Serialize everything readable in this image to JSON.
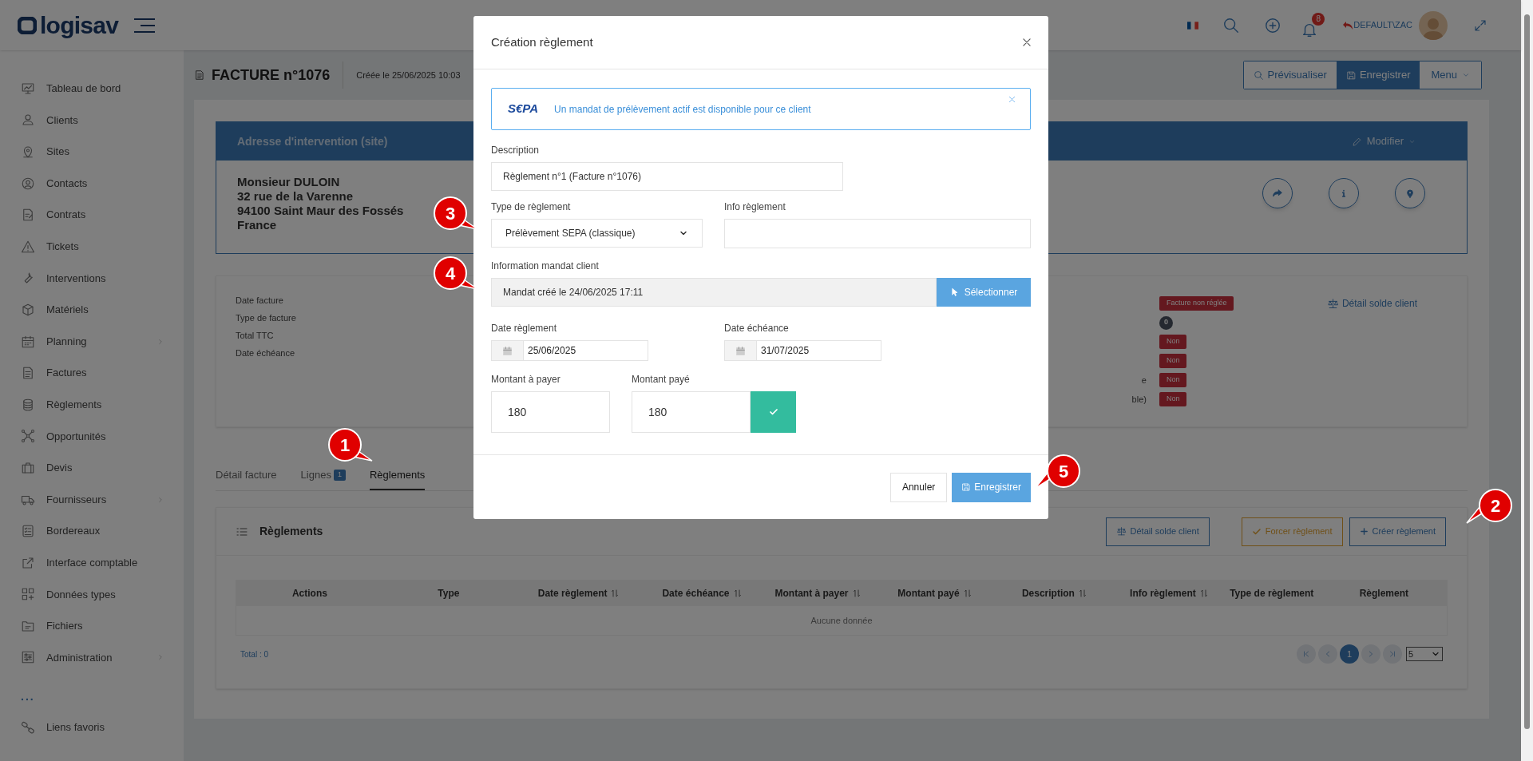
{
  "header": {
    "logo": "logisav",
    "notifications": "8",
    "user": "DEFAULT\\ZAC"
  },
  "sidebar": {
    "items": [
      {
        "label": "Tableau de bord",
        "has_submenu": false
      },
      {
        "label": "Clients",
        "has_submenu": false
      },
      {
        "label": "Sites",
        "has_submenu": false
      },
      {
        "label": "Contacts",
        "has_submenu": false
      },
      {
        "label": "Contrats",
        "has_submenu": false
      },
      {
        "label": "Tickets",
        "has_submenu": false
      },
      {
        "label": "Interventions",
        "has_submenu": false
      },
      {
        "label": "Matériels",
        "has_submenu": false
      },
      {
        "label": "Planning",
        "has_submenu": true
      },
      {
        "label": "Factures",
        "has_submenu": false
      },
      {
        "label": "Règlements",
        "has_submenu": false
      },
      {
        "label": "Opportunités",
        "has_submenu": false
      },
      {
        "label": "Devis",
        "has_submenu": false
      },
      {
        "label": "Fournisseurs",
        "has_submenu": true
      },
      {
        "label": "Bordereaux",
        "has_submenu": false
      },
      {
        "label": "Interface comptable",
        "has_submenu": false
      },
      {
        "label": "Données types",
        "has_submenu": false
      },
      {
        "label": "Fichiers",
        "has_submenu": false
      },
      {
        "label": "Administration",
        "has_submenu": true
      }
    ],
    "more": "...",
    "favorites": "Liens favoris"
  },
  "page": {
    "title": "FACTURE n°1076",
    "created": "Créée le 25/06/2025 10:03",
    "toolbar": [
      {
        "label": "Prévisualiser",
        "kind": "preview"
      },
      {
        "label": "Enregistrer",
        "kind": "save"
      },
      {
        "label": "Menu",
        "kind": "dropdown"
      }
    ]
  },
  "address": {
    "title": "Adresse d'intervention (site)",
    "edit": "Modifier",
    "lines": [
      "Monsieur DULOIN",
      "32 rue de la Varenne",
      "94100 Saint Maur des Fossés",
      "France"
    ]
  },
  "info": {
    "labels": [
      "Date facture",
      "Type de facture",
      "Total TTC",
      "Date échéance"
    ],
    "status_rows": [
      {
        "label": "",
        "badge": "Facture non réglée",
        "kind": "danger"
      },
      {
        "label": "",
        "badge": "0",
        "kind": "count"
      },
      {
        "label": "",
        "badge": "Non",
        "kind": "danger"
      },
      {
        "label": "",
        "badge": "Non",
        "kind": "danger"
      },
      {
        "label": "e",
        "badge": "Non",
        "kind": "danger"
      },
      {
        "label": "ble)",
        "badge": "Non",
        "kind": "danger"
      }
    ],
    "link": "Détail solde client"
  },
  "tabs": [
    {
      "label": "Détail facture",
      "selected": false
    },
    {
      "label": "Lignes",
      "badge": "1",
      "selected": false
    },
    {
      "label": "Règlements",
      "selected": true
    }
  ],
  "payments": {
    "title": "Règlements",
    "buttons": [
      {
        "label": "Détail solde client",
        "kind": "balance"
      },
      {
        "label": "Forcer règlement",
        "kind": "force"
      },
      {
        "label": "Créer règlement",
        "kind": "create"
      }
    ],
    "columns": [
      {
        "label": "Actions",
        "sortable": false
      },
      {
        "label": "Type",
        "sortable": false
      },
      {
        "label": "Date règlement",
        "sortable": true
      },
      {
        "label": "Date échéance",
        "sortable": true
      },
      {
        "label": "Montant à payer",
        "sortable": true
      },
      {
        "label": "Montant payé",
        "sortable": true
      },
      {
        "label": "Description",
        "sortable": true
      },
      {
        "label": "Info règlement",
        "sortable": true
      },
      {
        "label": "Type de règlement",
        "sortable": false
      },
      {
        "label": "Règlement",
        "sortable": false
      }
    ],
    "empty": "Aucune donnée",
    "total": "Total : 0",
    "current_page": "1",
    "page_size": "5"
  },
  "modal": {
    "title": "Création règlement",
    "alert": {
      "logo": "S€PA",
      "text": "Un mandat de prélèvement actif est disponible pour ce client"
    },
    "description": {
      "label": "Description",
      "value": "Règlement n°1 (Facture n°1076)"
    },
    "payment_type": {
      "label": "Type de règlement",
      "value": "Prélèvement SEPA (classique)"
    },
    "payment_info": {
      "label": "Info règlement"
    },
    "mandate": {
      "label": "Information mandat client",
      "value": "Mandat créé le 24/06/2025 17:11",
      "button": "Sélectionner"
    },
    "payment_date": {
      "label": "Date règlement",
      "value": "25/06/2025"
    },
    "due_date": {
      "label": "Date échéance",
      "value": "31/07/2025"
    },
    "amount_due": {
      "label": "Montant à payer",
      "value": "180"
    },
    "amount_paid": {
      "label": "Montant payé",
      "value": "180"
    },
    "cancel": "Annuler",
    "save": "Enregistrer"
  },
  "callouts": [
    "1",
    "2",
    "3",
    "4",
    "5"
  ]
}
